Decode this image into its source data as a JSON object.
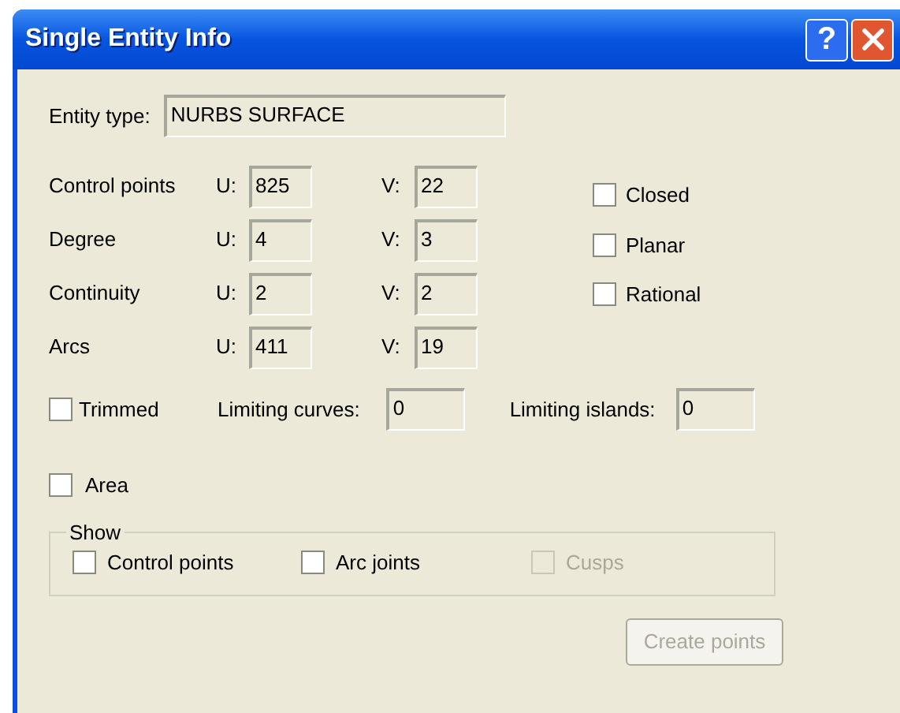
{
  "window": {
    "title": "Single Entity Info",
    "help_button": "?"
  },
  "entity_type": {
    "label": "Entity type:",
    "value": "NURBS SURFACE"
  },
  "properties": [
    {
      "label": "Control points",
      "u_label": "U:",
      "u_value": "825",
      "v_label": "V:",
      "v_value": "22"
    },
    {
      "label": "Degree",
      "u_label": "U:",
      "u_value": "4",
      "v_label": "V:",
      "v_value": "3"
    },
    {
      "label": "Continuity",
      "u_label": "U:",
      "u_value": "2",
      "v_label": "V:",
      "v_value": "2"
    },
    {
      "label": "Arcs",
      "u_label": "U:",
      "u_value": "411",
      "v_label": "V:",
      "v_value": "19"
    }
  ],
  "flags": [
    {
      "label": "Closed",
      "checked": false
    },
    {
      "label": "Planar",
      "checked": false
    },
    {
      "label": "Rational",
      "checked": false
    }
  ],
  "trimmed": {
    "label": "Trimmed",
    "checked": false
  },
  "limiting_curves": {
    "label": "Limiting curves:",
    "value": "0"
  },
  "limiting_islands": {
    "label": "Limiting islands:",
    "value": "0"
  },
  "area": {
    "label": "Area",
    "checked": false
  },
  "show": {
    "title": "Show",
    "options": [
      {
        "label": "Control points",
        "checked": false,
        "disabled": false
      },
      {
        "label": "Arc joints",
        "checked": false,
        "disabled": false
      },
      {
        "label": "Cusps",
        "checked": false,
        "disabled": true
      }
    ]
  },
  "create_button": {
    "label": "Create points",
    "disabled": true
  }
}
